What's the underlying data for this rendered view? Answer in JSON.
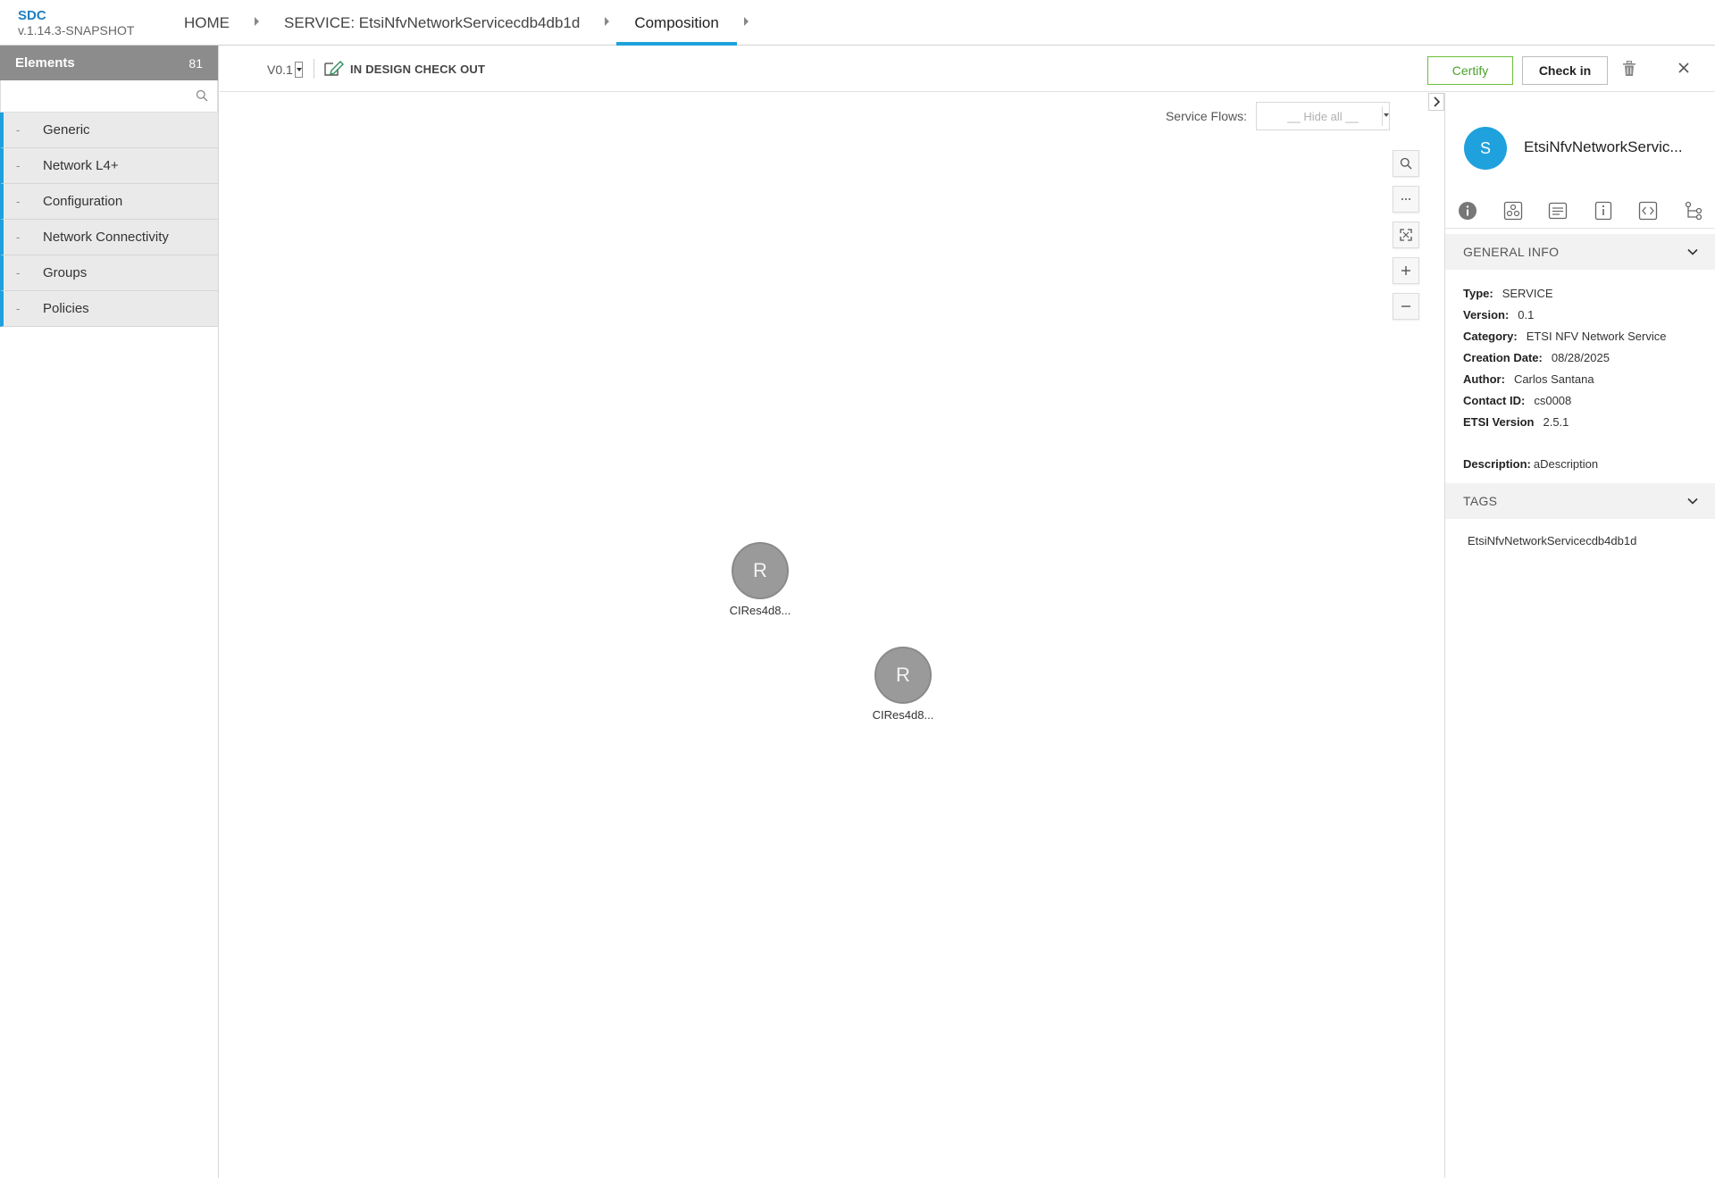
{
  "header": {
    "brand": "SDC",
    "version": "v.1.14.3-SNAPSHOT",
    "breadcrumbs": [
      {
        "label": "HOME"
      },
      {
        "label": "SERVICE: EtsiNfvNetworkServicecdb4db1d"
      },
      {
        "label": "Composition"
      }
    ]
  },
  "palette": {
    "title": "Elements",
    "count": "81",
    "search_value": "",
    "search_placeholder": "",
    "dash": "-",
    "categories": [
      {
        "label": "Generic"
      },
      {
        "label": "Network L4+"
      },
      {
        "label": "Configuration"
      },
      {
        "label": "Network Connectivity"
      },
      {
        "label": "Groups"
      },
      {
        "label": "Policies"
      }
    ]
  },
  "toolbar": {
    "version": "V0.1",
    "status": "IN DESIGN CHECK OUT",
    "certify_label": "Certify",
    "checkin_label": "Check in"
  },
  "canvas": {
    "service_flows_label": "Service Flows:",
    "service_flows_value": "__ Hide all __",
    "zoom_tools": [
      "search-icon",
      "more-icon",
      "fit-screen-icon",
      "zoom-in-icon",
      "zoom-out-icon"
    ],
    "nodes": [
      {
        "initial": "R",
        "label": "CIRes4d8..."
      },
      {
        "initial": "R",
        "label": "CIRes4d8..."
      }
    ]
  },
  "right_panel": {
    "avatar_initial": "S",
    "name": "EtsiNfvNetworkServic...",
    "tabs": [
      "info-icon",
      "composition-icon",
      "deployment-artifacts-icon",
      "properties-icon",
      "api-icon",
      "hierarchy-icon"
    ],
    "general_info": {
      "title": "GENERAL INFO",
      "rows": [
        {
          "key": "Type:",
          "value": "SERVICE"
        },
        {
          "key": "Version:",
          "value": "0.1"
        },
        {
          "key": "Category:",
          "value": "ETSI NFV Network Service"
        },
        {
          "key": "Creation Date:",
          "value": "08/28/2025"
        },
        {
          "key": "Author:",
          "value": "Carlos Santana"
        },
        {
          "key": "Contact ID:",
          "value": "cs0008"
        },
        {
          "key": "ETSI Version",
          "value": "2.5.1"
        }
      ],
      "description_key": "Description:",
      "description_value": "aDescription"
    },
    "tags": {
      "title": "TAGS",
      "items": [
        "EtsiNfvNetworkServicecdb4db1d"
      ]
    }
  },
  "colors": {
    "accent": "#1ea1dd",
    "certify": "#4aa12a",
    "palette_header": "#8c8c8c",
    "node": "#9a9a9a"
  }
}
